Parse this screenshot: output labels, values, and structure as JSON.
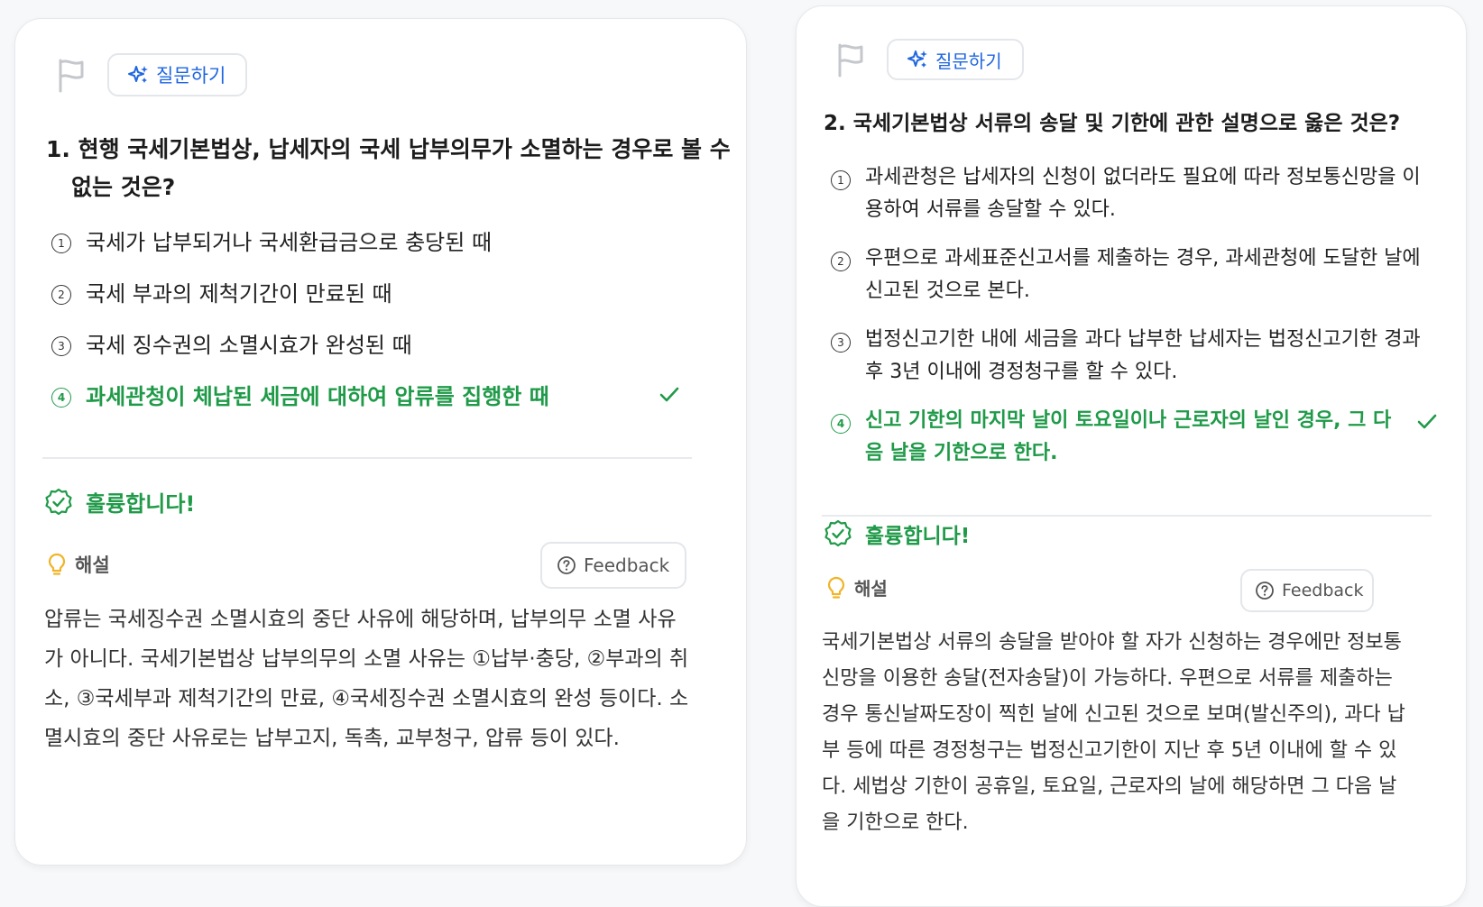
{
  "ask_label": "질문하기",
  "result_label": "훌륭합니다!",
  "explanation_label": "해설",
  "feedback_label": "Feedback",
  "colors": {
    "accent": "#1f66e0",
    "correct": "#1f9a48",
    "hint": "#f0b429"
  },
  "icons": {
    "flag": "flag-icon",
    "ask": "sparkle-icon",
    "correct_check": "check-icon",
    "result": "badge-check-icon",
    "explanation": "lightbulb-icon",
    "feedback": "help-circle-icon"
  },
  "questions": [
    {
      "title": "1. 현행 국세기본법상, 납세자의 국세 납부의무가 소멸하는 경우로 볼 수 없는 것은?",
      "options": [
        {
          "num": "1",
          "text": "국세가 납부되거나 국세환급금으로 충당된 때",
          "correct": false
        },
        {
          "num": "2",
          "text": "국세 부과의 제척기간이 만료된 때",
          "correct": false
        },
        {
          "num": "3",
          "text": "국세 징수권의 소멸시효가 완성된 때",
          "correct": false
        },
        {
          "num": "4",
          "text": "과세관청이 체납된 세금에 대하여 압류를 집행한 때",
          "correct": true
        }
      ],
      "explanation": "압류는 국세징수권 소멸시효의 중단 사유에 해당하며, 납부의무 소멸 사유가 아니다. 국세기본법상 납부의무의 소멸 사유는 ①납부·충당, ②부과의 취소, ③국세부과 제척기간의 만료, ④국세징수권 소멸시효의 완성 등이다. 소멸시효의 중단 사유로는 납부고지, 독촉, 교부청구, 압류 등이 있다."
    },
    {
      "title": "2. 국세기본법상 서류의 송달 및 기한에 관한 설명으로 옳은 것은?",
      "options": [
        {
          "num": "1",
          "text": "과세관청은 납세자의 신청이 없더라도 필요에 따라 정보통신망을 이용하여 서류를 송달할 수 있다.",
          "correct": false
        },
        {
          "num": "2",
          "text": "우편으로 과세표준신고서를 제출하는 경우, 과세관청에 도달한 날에 신고된 것으로 본다.",
          "correct": false
        },
        {
          "num": "3",
          "text": "법정신고기한 내에 세금을 과다 납부한 납세자는 법정신고기한 경과 후 3년 이내에 경정청구를 할 수 있다.",
          "correct": false
        },
        {
          "num": "4",
          "text": "신고 기한의 마지막 날이 토요일이나 근로자의 날인 경우, 그 다음 날을 기한으로 한다.",
          "correct": true
        }
      ],
      "explanation": "국세기본법상 서류의 송달을 받아야 할 자가 신청하는 경우에만 정보통신망을 이용한 송달(전자송달)이 가능하다. 우편으로 서류를 제출하는 경우 통신날짜도장이 찍힌 날에 신고된 것으로 보며(발신주의), 과다 납부 등에 따른 경정청구는 법정신고기한이 지난 후 5년 이내에 할 수 있다. 세법상 기한이 공휴일, 토요일, 근로자의 날에 해당하면 그 다음 날을 기한으로 한다."
    }
  ]
}
